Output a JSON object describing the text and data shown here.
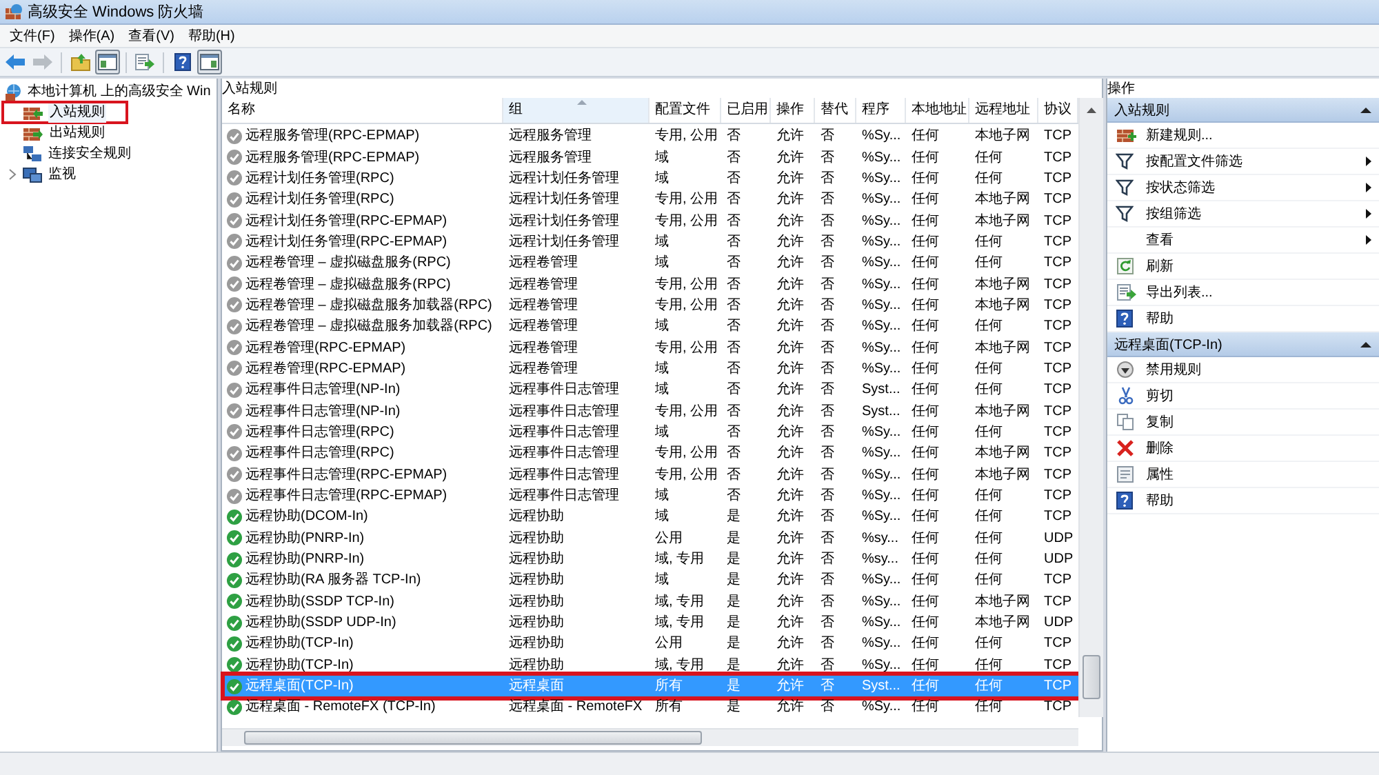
{
  "window": {
    "title": "高级安全 Windows 防火墙"
  },
  "menu": [
    "文件(F)",
    "操作(A)",
    "查看(V)",
    "帮助(H)"
  ],
  "toolbar": [
    {
      "kind": "back",
      "disabled": false,
      "pressed": false
    },
    {
      "kind": "forward",
      "disabled": true,
      "pressed": false
    },
    {
      "kind": "up",
      "disabled": false,
      "pressed": false
    },
    {
      "kind": "tree",
      "disabled": false,
      "pressed": true
    },
    {
      "kind": "export",
      "disabled": false,
      "pressed": false
    },
    {
      "kind": "help",
      "disabled": false,
      "pressed": false
    },
    {
      "kind": "pane",
      "disabled": false,
      "pressed": true
    }
  ],
  "tree": {
    "root": "本地计算机 上的高级安全 Win",
    "items": [
      {
        "label": "入站规则",
        "kind": "inbound",
        "selected": true,
        "highlighted": true,
        "expandable": false
      },
      {
        "label": "出站规则",
        "kind": "outbound",
        "selected": false,
        "highlighted": false,
        "expandable": false
      },
      {
        "label": "连接安全规则",
        "kind": "connection",
        "selected": false,
        "highlighted": false,
        "expandable": false
      },
      {
        "label": "监视",
        "kind": "monitor",
        "selected": false,
        "highlighted": false,
        "expandable": true
      }
    ]
  },
  "center": {
    "title": "入站规则",
    "columns": [
      {
        "label": "名称",
        "sorted": false
      },
      {
        "label": "组",
        "sorted": true
      },
      {
        "label": "配置文件",
        "sorted": false
      },
      {
        "label": "已启用",
        "sorted": false
      },
      {
        "label": "操作",
        "sorted": false
      },
      {
        "label": "替代",
        "sorted": false
      },
      {
        "label": "程序",
        "sorted": false
      },
      {
        "label": "本地地址",
        "sorted": false
      },
      {
        "label": "远程地址",
        "sorted": false
      },
      {
        "label": "协议",
        "sorted": false
      }
    ],
    "rows": [
      {
        "enabled": false,
        "selected": false,
        "highlighted": false,
        "cells": [
          "远程服务管理(RPC-EPMAP)",
          "远程服务管理",
          "专用, 公用",
          "否",
          "允许",
          "否",
          "%Sy...",
          "任何",
          "本地子网",
          "TCP"
        ]
      },
      {
        "enabled": false,
        "selected": false,
        "highlighted": false,
        "cells": [
          "远程服务管理(RPC-EPMAP)",
          "远程服务管理",
          "域",
          "否",
          "允许",
          "否",
          "%Sy...",
          "任何",
          "任何",
          "TCP"
        ]
      },
      {
        "enabled": false,
        "selected": false,
        "highlighted": false,
        "cells": [
          "远程计划任务管理(RPC)",
          "远程计划任务管理",
          "域",
          "否",
          "允许",
          "否",
          "%Sy...",
          "任何",
          "任何",
          "TCP"
        ]
      },
      {
        "enabled": false,
        "selected": false,
        "highlighted": false,
        "cells": [
          "远程计划任务管理(RPC)",
          "远程计划任务管理",
          "专用, 公用",
          "否",
          "允许",
          "否",
          "%Sy...",
          "任何",
          "本地子网",
          "TCP"
        ]
      },
      {
        "enabled": false,
        "selected": false,
        "highlighted": false,
        "cells": [
          "远程计划任务管理(RPC-EPMAP)",
          "远程计划任务管理",
          "专用, 公用",
          "否",
          "允许",
          "否",
          "%Sy...",
          "任何",
          "本地子网",
          "TCP"
        ]
      },
      {
        "enabled": false,
        "selected": false,
        "highlighted": false,
        "cells": [
          "远程计划任务管理(RPC-EPMAP)",
          "远程计划任务管理",
          "域",
          "否",
          "允许",
          "否",
          "%Sy...",
          "任何",
          "任何",
          "TCP"
        ]
      },
      {
        "enabled": false,
        "selected": false,
        "highlighted": false,
        "cells": [
          "远程卷管理 – 虚拟磁盘服务(RPC)",
          "远程卷管理",
          "域",
          "否",
          "允许",
          "否",
          "%Sy...",
          "任何",
          "任何",
          "TCP"
        ]
      },
      {
        "enabled": false,
        "selected": false,
        "highlighted": false,
        "cells": [
          "远程卷管理 – 虚拟磁盘服务(RPC)",
          "远程卷管理",
          "专用, 公用",
          "否",
          "允许",
          "否",
          "%Sy...",
          "任何",
          "本地子网",
          "TCP"
        ]
      },
      {
        "enabled": false,
        "selected": false,
        "highlighted": false,
        "cells": [
          "远程卷管理 – 虚拟磁盘服务加载器(RPC)",
          "远程卷管理",
          "专用, 公用",
          "否",
          "允许",
          "否",
          "%Sy...",
          "任何",
          "本地子网",
          "TCP"
        ]
      },
      {
        "enabled": false,
        "selected": false,
        "highlighted": false,
        "cells": [
          "远程卷管理 – 虚拟磁盘服务加载器(RPC)",
          "远程卷管理",
          "域",
          "否",
          "允许",
          "否",
          "%Sy...",
          "任何",
          "任何",
          "TCP"
        ]
      },
      {
        "enabled": false,
        "selected": false,
        "highlighted": false,
        "cells": [
          "远程卷管理(RPC-EPMAP)",
          "远程卷管理",
          "专用, 公用",
          "否",
          "允许",
          "否",
          "%Sy...",
          "任何",
          "本地子网",
          "TCP"
        ]
      },
      {
        "enabled": false,
        "selected": false,
        "highlighted": false,
        "cells": [
          "远程卷管理(RPC-EPMAP)",
          "远程卷管理",
          "域",
          "否",
          "允许",
          "否",
          "%Sy...",
          "任何",
          "任何",
          "TCP"
        ]
      },
      {
        "enabled": false,
        "selected": false,
        "highlighted": false,
        "cells": [
          "远程事件日志管理(NP-In)",
          "远程事件日志管理",
          "域",
          "否",
          "允许",
          "否",
          "Syst...",
          "任何",
          "任何",
          "TCP"
        ]
      },
      {
        "enabled": false,
        "selected": false,
        "highlighted": false,
        "cells": [
          "远程事件日志管理(NP-In)",
          "远程事件日志管理",
          "专用, 公用",
          "否",
          "允许",
          "否",
          "Syst...",
          "任何",
          "本地子网",
          "TCP"
        ]
      },
      {
        "enabled": false,
        "selected": false,
        "highlighted": false,
        "cells": [
          "远程事件日志管理(RPC)",
          "远程事件日志管理",
          "域",
          "否",
          "允许",
          "否",
          "%Sy...",
          "任何",
          "任何",
          "TCP"
        ]
      },
      {
        "enabled": false,
        "selected": false,
        "highlighted": false,
        "cells": [
          "远程事件日志管理(RPC)",
          "远程事件日志管理",
          "专用, 公用",
          "否",
          "允许",
          "否",
          "%Sy...",
          "任何",
          "本地子网",
          "TCP"
        ]
      },
      {
        "enabled": false,
        "selected": false,
        "highlighted": false,
        "cells": [
          "远程事件日志管理(RPC-EPMAP)",
          "远程事件日志管理",
          "专用, 公用",
          "否",
          "允许",
          "否",
          "%Sy...",
          "任何",
          "本地子网",
          "TCP"
        ]
      },
      {
        "enabled": false,
        "selected": false,
        "highlighted": false,
        "cells": [
          "远程事件日志管理(RPC-EPMAP)",
          "远程事件日志管理",
          "域",
          "否",
          "允许",
          "否",
          "%Sy...",
          "任何",
          "任何",
          "TCP"
        ]
      },
      {
        "enabled": true,
        "selected": false,
        "highlighted": false,
        "cells": [
          "远程协助(DCOM-In)",
          "远程协助",
          "域",
          "是",
          "允许",
          "否",
          "%Sy...",
          "任何",
          "任何",
          "TCP"
        ]
      },
      {
        "enabled": true,
        "selected": false,
        "highlighted": false,
        "cells": [
          "远程协助(PNRP-In)",
          "远程协助",
          "公用",
          "是",
          "允许",
          "否",
          "%sy...",
          "任何",
          "任何",
          "UDP"
        ]
      },
      {
        "enabled": true,
        "selected": false,
        "highlighted": false,
        "cells": [
          "远程协助(PNRP-In)",
          "远程协助",
          "域, 专用",
          "是",
          "允许",
          "否",
          "%sy...",
          "任何",
          "任何",
          "UDP"
        ]
      },
      {
        "enabled": true,
        "selected": false,
        "highlighted": false,
        "cells": [
          "远程协助(RA 服务器 TCP-In)",
          "远程协助",
          "域",
          "是",
          "允许",
          "否",
          "%Sy...",
          "任何",
          "任何",
          "TCP"
        ]
      },
      {
        "enabled": true,
        "selected": false,
        "highlighted": false,
        "cells": [
          "远程协助(SSDP TCP-In)",
          "远程协助",
          "域, 专用",
          "是",
          "允许",
          "否",
          "%Sy...",
          "任何",
          "本地子网",
          "TCP"
        ]
      },
      {
        "enabled": true,
        "selected": false,
        "highlighted": false,
        "cells": [
          "远程协助(SSDP UDP-In)",
          "远程协助",
          "域, 专用",
          "是",
          "允许",
          "否",
          "%Sy...",
          "任何",
          "本地子网",
          "UDP"
        ]
      },
      {
        "enabled": true,
        "selected": false,
        "highlighted": false,
        "cells": [
          "远程协助(TCP-In)",
          "远程协助",
          "公用",
          "是",
          "允许",
          "否",
          "%Sy...",
          "任何",
          "任何",
          "TCP"
        ]
      },
      {
        "enabled": true,
        "selected": false,
        "highlighted": false,
        "cells": [
          "远程协助(TCP-In)",
          "远程协助",
          "域, 专用",
          "是",
          "允许",
          "否",
          "%Sy...",
          "任何",
          "任何",
          "TCP"
        ]
      },
      {
        "enabled": true,
        "selected": true,
        "highlighted": true,
        "cells": [
          "远程桌面(TCP-In)",
          "远程桌面",
          "所有",
          "是",
          "允许",
          "否",
          "Syst...",
          "任何",
          "任何",
          "TCP"
        ]
      },
      {
        "enabled": true,
        "selected": false,
        "highlighted": false,
        "cells": [
          "远程桌面 - RemoteFX (TCP-In)",
          "远程桌面 - RemoteFX",
          "所有",
          "是",
          "允许",
          "否",
          "%Sy...",
          "任何",
          "任何",
          "TCP"
        ]
      }
    ]
  },
  "actions": {
    "title": "操作",
    "sections": [
      {
        "title": "入站规则",
        "expanded": true,
        "items": [
          {
            "label": "新建规则...",
            "kind": "new-rule",
            "submenu": false
          },
          {
            "label": "按配置文件筛选",
            "kind": "filter",
            "submenu": true
          },
          {
            "label": "按状态筛选",
            "kind": "filter",
            "submenu": true
          },
          {
            "label": "按组筛选",
            "kind": "filter",
            "submenu": true
          },
          {
            "label": "查看",
            "kind": "none",
            "submenu": true
          },
          {
            "label": "刷新",
            "kind": "refresh",
            "submenu": false
          },
          {
            "label": "导出列表...",
            "kind": "export",
            "submenu": false
          },
          {
            "label": "帮助",
            "kind": "help",
            "submenu": false
          }
        ]
      },
      {
        "title": "远程桌面(TCP-In)",
        "expanded": true,
        "items": [
          {
            "label": "禁用规则",
            "kind": "disable",
            "submenu": false
          },
          {
            "label": "剪切",
            "kind": "cut",
            "submenu": false
          },
          {
            "label": "复制",
            "kind": "copy",
            "submenu": false
          },
          {
            "label": "删除",
            "kind": "delete",
            "submenu": false
          },
          {
            "label": "属性",
            "kind": "properties",
            "submenu": false
          },
          {
            "label": "帮助",
            "kind": "help",
            "submenu": false
          }
        ]
      }
    ]
  }
}
